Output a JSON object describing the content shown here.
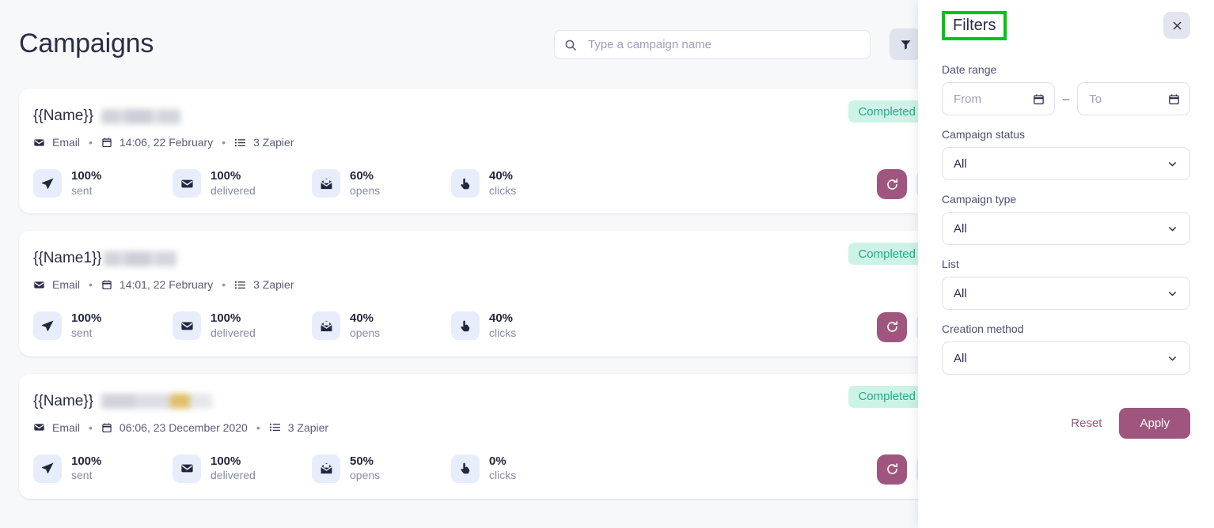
{
  "header": {
    "title": "Campaigns",
    "search": {
      "placeholder": "Type a campaign name",
      "value": "",
      "icon": "search-icon"
    },
    "filter_button_icon": "funnel-icon"
  },
  "campaigns": [
    {
      "name": "{{Name}}",
      "name_redacted": true,
      "channel": "Email",
      "datetime": "14:06, 22 February",
      "list": "3 Zapier",
      "status": "Completed",
      "status_color": "#23a98a",
      "status_bg": "#cdf3e6",
      "metrics": [
        {
          "value": "100%",
          "label": "sent",
          "icon": "send-icon"
        },
        {
          "value": "100%",
          "label": "delivered",
          "icon": "envelope-icon"
        },
        {
          "value": "60%",
          "label": "opens",
          "icon": "open-envelope-icon"
        },
        {
          "value": "40%",
          "label": "clicks",
          "icon": "pointer-hand-icon"
        }
      ]
    },
    {
      "name": "{{Name1}}",
      "name_redacted": true,
      "channel": "Email",
      "datetime": "14:01, 22 February",
      "list": "3 Zapier",
      "status": "Completed",
      "status_color": "#23a98a",
      "status_bg": "#cdf3e6",
      "metrics": [
        {
          "value": "100%",
          "label": "sent",
          "icon": "send-icon"
        },
        {
          "value": "100%",
          "label": "delivered",
          "icon": "envelope-icon"
        },
        {
          "value": "40%",
          "label": "opens",
          "icon": "open-envelope-icon"
        },
        {
          "value": "40%",
          "label": "clicks",
          "icon": "pointer-hand-icon"
        }
      ]
    },
    {
      "name": "{{Name}}",
      "name_redacted": true,
      "channel": "Email",
      "datetime": "06:06, 23 December 2020",
      "list": "3 Zapier",
      "status": "Completed",
      "status_color": "#23a98a",
      "status_bg": "#cdf3e6",
      "metrics": [
        {
          "value": "100%",
          "label": "sent",
          "icon": "send-icon"
        },
        {
          "value": "100%",
          "label": "delivered",
          "icon": "envelope-icon"
        },
        {
          "value": "50%",
          "label": "opens",
          "icon": "open-envelope-icon"
        },
        {
          "value": "0%",
          "label": "clicks",
          "icon": "pointer-hand-icon"
        }
      ]
    }
  ],
  "card_actions": {
    "refresh_icon": "refresh-icon",
    "more_icon": "kebab-menu-icon",
    "status_flag_icon": "flag-icon"
  },
  "filters_panel": {
    "title": "Filters",
    "title_highlight_color": "#00c40f",
    "close_icon": "close-icon",
    "date_range": {
      "label": "Date range",
      "from_placeholder": "From",
      "to_placeholder": "To",
      "separator": "–",
      "icon": "calendar-icon"
    },
    "selects": [
      {
        "label": "Campaign status",
        "value": "All",
        "icon": "chevron-down-icon"
      },
      {
        "label": "Campaign type",
        "value": "All",
        "icon": "chevron-down-icon"
      },
      {
        "label": "List",
        "value": "All",
        "icon": "chevron-down-icon"
      },
      {
        "label": "Creation method",
        "value": "All",
        "icon": "chevron-down-icon"
      }
    ],
    "reset_label": "Reset",
    "apply_label": "Apply",
    "accent_color": "#a0557f"
  }
}
